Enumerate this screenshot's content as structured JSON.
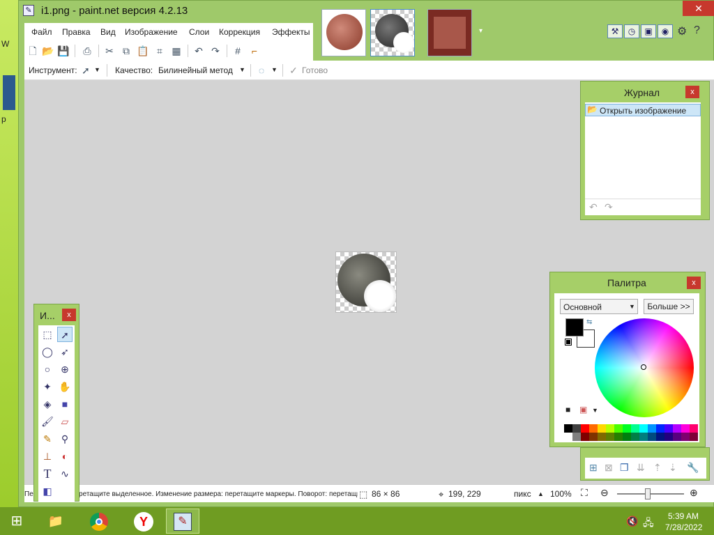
{
  "window": {
    "title": "i1.png - paint.net версия 4.2.13",
    "close_glyph": "✕"
  },
  "menu": [
    "Файл",
    "Правка",
    "Вид",
    "Изображение",
    "Слои",
    "Коррекция",
    "Эффекты"
  ],
  "toolbar2": {
    "tool_label": "Инструмент:",
    "quality_label": "Качество:",
    "quality_value": "Билинейный метод",
    "done_label": "Готово"
  },
  "journal": {
    "title": "Журнал",
    "item": "Открыть изображение"
  },
  "palette": {
    "title": "Палитра",
    "mode": "Основной",
    "more_button": "Больше >>",
    "colors_top": [
      "#000000",
      "#404040",
      "#ff0000",
      "#ff6a00",
      "#ffd800",
      "#b6ff00",
      "#4cff00",
      "#00ff21",
      "#00ff90",
      "#00ffff",
      "#0094ff",
      "#0026ff",
      "#4800ff",
      "#b200ff",
      "#ff00dc",
      "#ff006e"
    ],
    "colors_bottom": [
      "#ffffff",
      "#808080",
      "#7f0000",
      "#7f3300",
      "#7f6a00",
      "#5b7f00",
      "#267f00",
      "#007f0e",
      "#007f46",
      "#007f7f",
      "#004a7f",
      "#00137f",
      "#21007f",
      "#57007f",
      "#7f006e",
      "#7f0037"
    ]
  },
  "tools_panel": {
    "title": "И...",
    "close_glyph": "x"
  },
  "statusbar": {
    "hint": "Переместите: перетащите выделенное. Изменение размера: перетащите маркеры. Поворот: перетащите с правой кнопкой.",
    "size": "86 × 86",
    "position": "199, 229",
    "unit": "пикс",
    "zoom": "100%"
  },
  "taskbar": {
    "time": "5:39 AM",
    "date": "7/28/2022"
  },
  "desktop": {
    "partial_label_1": "W",
    "partial_label_2": "p"
  }
}
